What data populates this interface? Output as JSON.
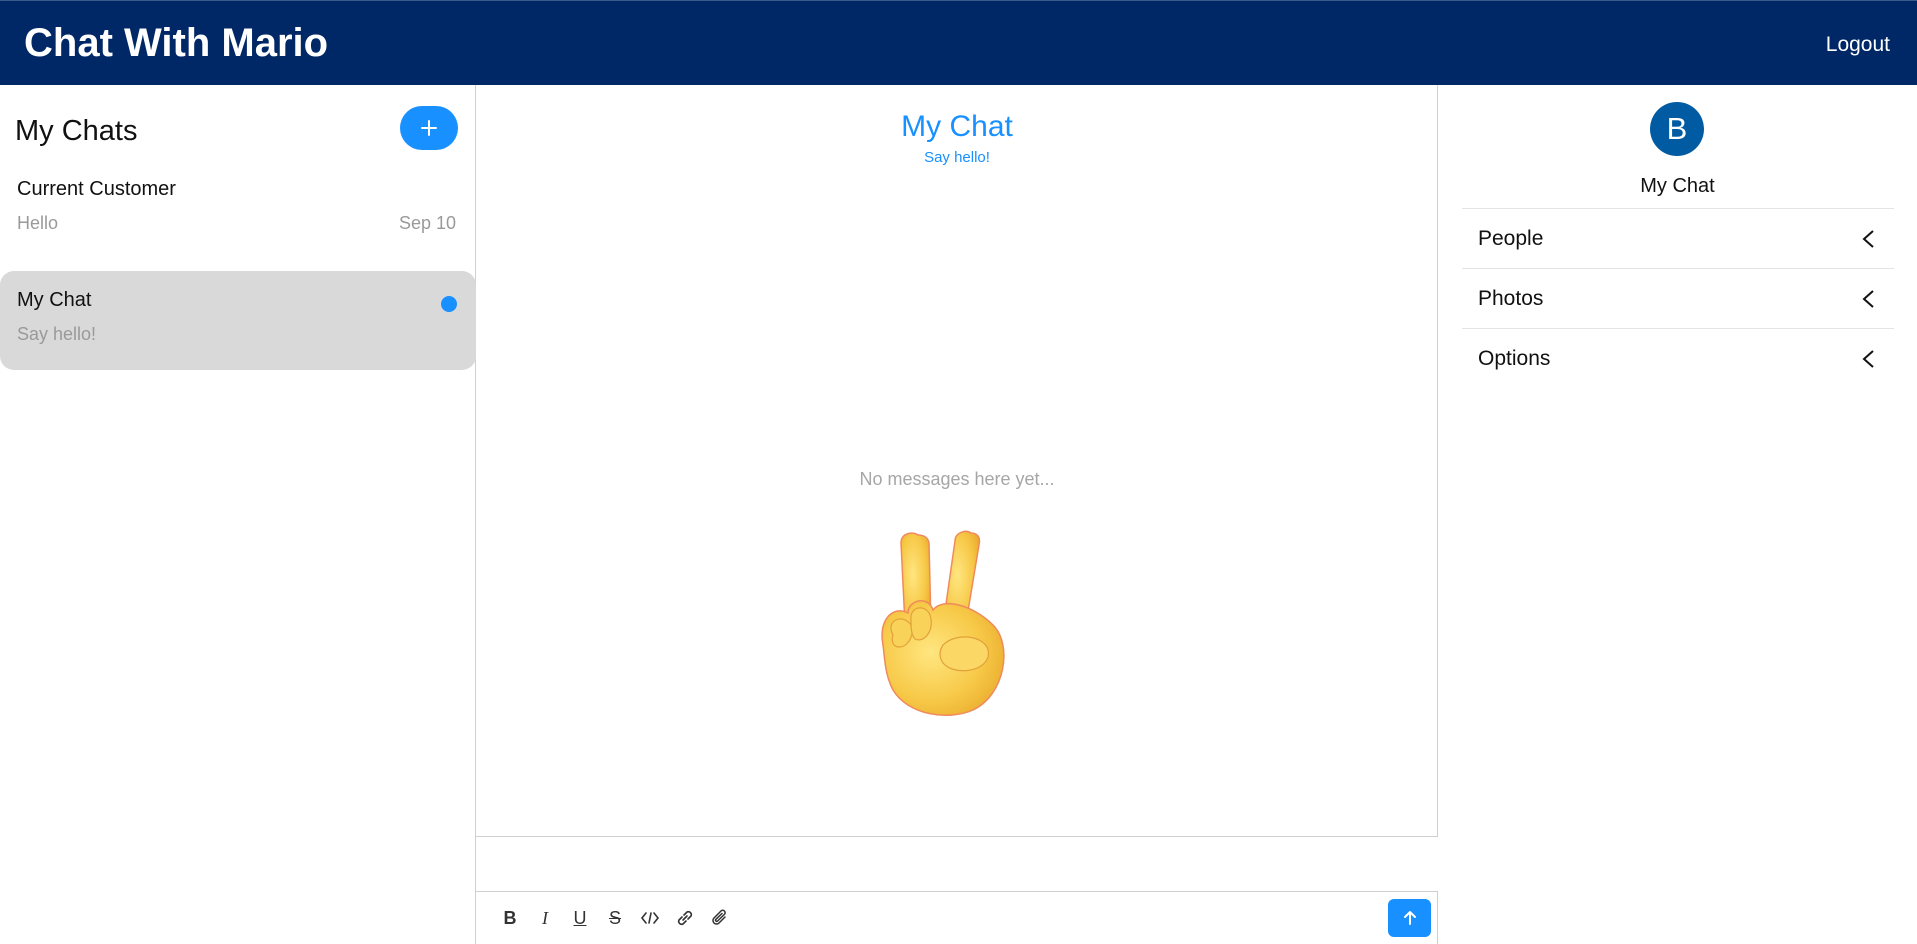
{
  "header": {
    "title": "Chat With Mario",
    "logout_label": "Logout",
    "background": "#002766"
  },
  "sidebar": {
    "title": "My Chats",
    "new_chat_icon": "plus-icon",
    "chats": [
      {
        "name": "Current Customer",
        "preview": "Hello",
        "date": "Sep 10",
        "active": false,
        "unread": false
      },
      {
        "name": "My Chat",
        "preview": "Say hello!",
        "date": "",
        "active": true,
        "unread": true
      }
    ]
  },
  "chat": {
    "title": "My Chat",
    "subtitle": "Say hello!",
    "empty_text": "No messages here yet...",
    "empty_icon": "victory-hand-emoji",
    "composer_value": "",
    "toolbar": [
      "bold-icon",
      "italic-icon",
      "underline-icon",
      "strikethrough-icon",
      "code-icon",
      "link-icon",
      "attachment-icon"
    ],
    "send_icon": "arrow-up-icon"
  },
  "details": {
    "avatar_letter": "B",
    "title": "My Chat",
    "sections": [
      "People",
      "Photos",
      "Options"
    ]
  },
  "colors": {
    "accent": "#1890ff",
    "nav": "#002766",
    "avatar": "#005ba3",
    "active_card": "#d9d9d9"
  }
}
